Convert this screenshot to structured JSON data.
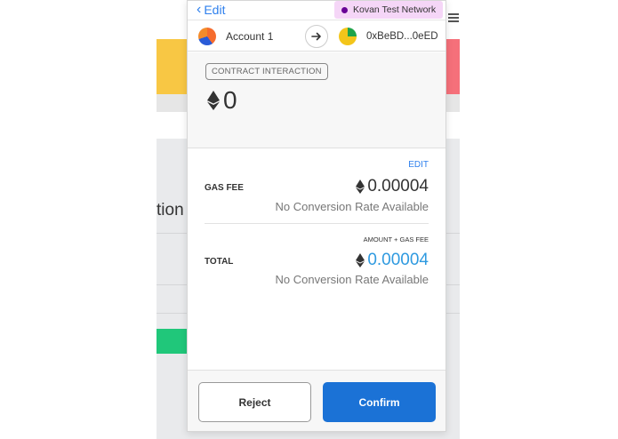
{
  "background": {
    "partial_text": "tion"
  },
  "topbar": {
    "back_label": "Edit",
    "network_label": "Kovan Test Network"
  },
  "accounts": {
    "from_name": "Account 1",
    "to_address": "0xBeBD...0eED"
  },
  "summary": {
    "action_label": "CONTRACT INTERACTION",
    "amount": "0"
  },
  "details": {
    "edit_label": "EDIT",
    "gas_fee_label": "GAS FEE",
    "gas_fee_value": "0.00004",
    "gas_fee_conversion": "No Conversion Rate Available",
    "total_sublabel": "AMOUNT + GAS FEE",
    "total_label": "TOTAL",
    "total_value": "0.00004",
    "total_conversion": "No Conversion Rate Available"
  },
  "footer": {
    "reject_label": "Reject",
    "confirm_label": "Confirm"
  },
  "colors": {
    "accent": "#1b72d6",
    "link": "#2f80ed",
    "total_value": "#2f9ae0",
    "network_badge": "#f5d6f7",
    "network_dot": "#690496"
  },
  "icons": [
    "chevron-left-icon",
    "network-dot-icon",
    "arrow-right-icon",
    "eth-icon",
    "menu-icon"
  ]
}
